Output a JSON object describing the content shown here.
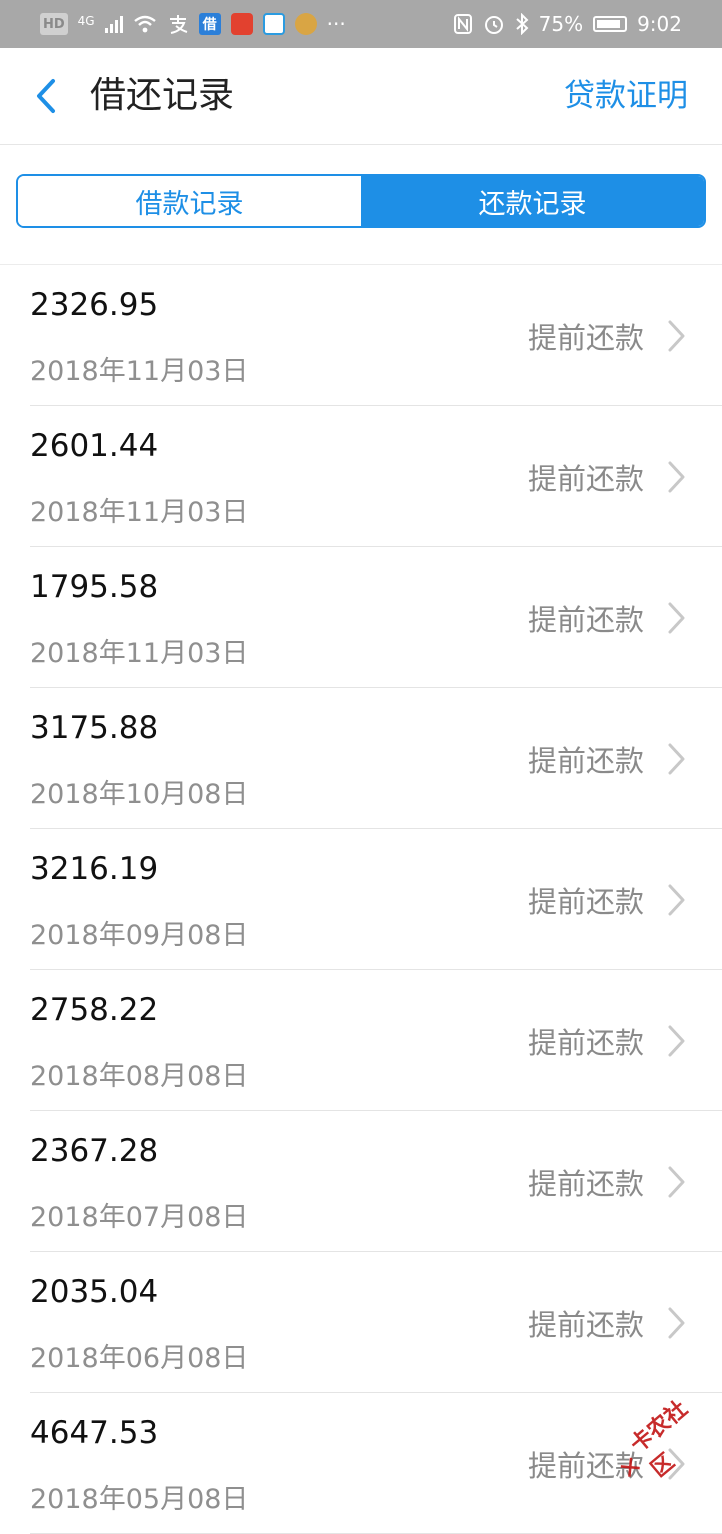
{
  "status_bar": {
    "hd": "HD",
    "network": "4G",
    "app_jie": "借",
    "battery": "75%",
    "time": "9:02",
    "more": "···"
  },
  "nav": {
    "title": "借还记录",
    "right_link": "贷款证明"
  },
  "tabs": [
    {
      "label": "借款记录",
      "active": false
    },
    {
      "label": "还款记录",
      "active": true
    }
  ],
  "records": [
    {
      "amount": "2326.95",
      "date": "2018年11月03日",
      "action": "提前还款"
    },
    {
      "amount": "2601.44",
      "date": "2018年11月03日",
      "action": "提前还款"
    },
    {
      "amount": "1795.58",
      "date": "2018年11月03日",
      "action": "提前还款"
    },
    {
      "amount": "3175.88",
      "date": "2018年10月08日",
      "action": "提前还款"
    },
    {
      "amount": "3216.19",
      "date": "2018年09月08日",
      "action": "提前还款"
    },
    {
      "amount": "2758.22",
      "date": "2018年08月08日",
      "action": "提前还款"
    },
    {
      "amount": "2367.28",
      "date": "2018年07月08日",
      "action": "提前还款"
    },
    {
      "amount": "2035.04",
      "date": "2018年06月08日",
      "action": "提前还款"
    },
    {
      "amount": "4647.53",
      "date": "2018年05月08日",
      "action": "提前还款"
    }
  ],
  "watermark": "卡农社区",
  "colors": {
    "accent": "#1e8fe6",
    "status_bar_bg": "#a8a8a8",
    "secondary_text": "#8f8f8f"
  }
}
